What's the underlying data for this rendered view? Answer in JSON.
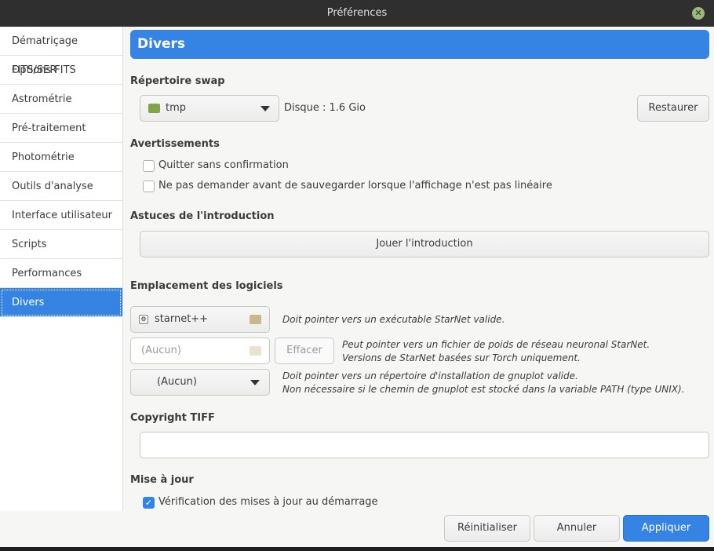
{
  "window": {
    "title": "Préférences"
  },
  "sidebar": {
    "items": [
      {
        "label": "Dématriçage FITS/SER"
      },
      {
        "label": "Options FITS"
      },
      {
        "label": "Astrométrie"
      },
      {
        "label": "Pré-traitement"
      },
      {
        "label": "Photométrie"
      },
      {
        "label": "Outils d'analyse"
      },
      {
        "label": "Interface utilisateur"
      },
      {
        "label": "Scripts"
      },
      {
        "label": "Performances"
      },
      {
        "label": "Divers"
      }
    ],
    "active": "Divers"
  },
  "page": {
    "title": "Divers"
  },
  "swap": {
    "heading": "Répertoire swap",
    "folder": "tmp",
    "disk": "Disque : 1.6 Gio",
    "restore": "Restaurer"
  },
  "warnings": {
    "heading": "Avertissements",
    "items": [
      {
        "label": "Quitter sans confirmation",
        "checked": false
      },
      {
        "label": "Ne pas demander avant de sauvegarder lorsque l'affichage n'est pas linéaire",
        "checked": false
      }
    ]
  },
  "intro": {
    "heading": "Astuces de l'introduction",
    "play": "Jouer l'introduction"
  },
  "software": {
    "heading": "Emplacement des logiciels",
    "starnet": "starnet++",
    "starnet_hint": "Doit pointer vers un exécutable StarNet valide.",
    "weights": "(Aucun)",
    "clear": "Effacer",
    "weights_hint1": "Peut pointer vers un fichier de poids de réseau neuronal StarNet.",
    "weights_hint2": "Versions de StarNet basées sur Torch uniquement.",
    "gnuplot": "(Aucun)",
    "gnuplot_hint1": "Doit pointer vers un répertoire d'installation de gnuplot valide.",
    "gnuplot_hint2": "Non nécessaire si le chemin de gnuplot est stocké dans la variable PATH (type UNIX)."
  },
  "tiff": {
    "heading": "Copyright TIFF",
    "value": ""
  },
  "update": {
    "heading": "Mise à jour",
    "check": "Vérification des mises à jour au démarrage",
    "checked": true
  },
  "footer": {
    "reset": "Réinitialiser",
    "cancel": "Annuler",
    "apply": "Appliquer"
  }
}
